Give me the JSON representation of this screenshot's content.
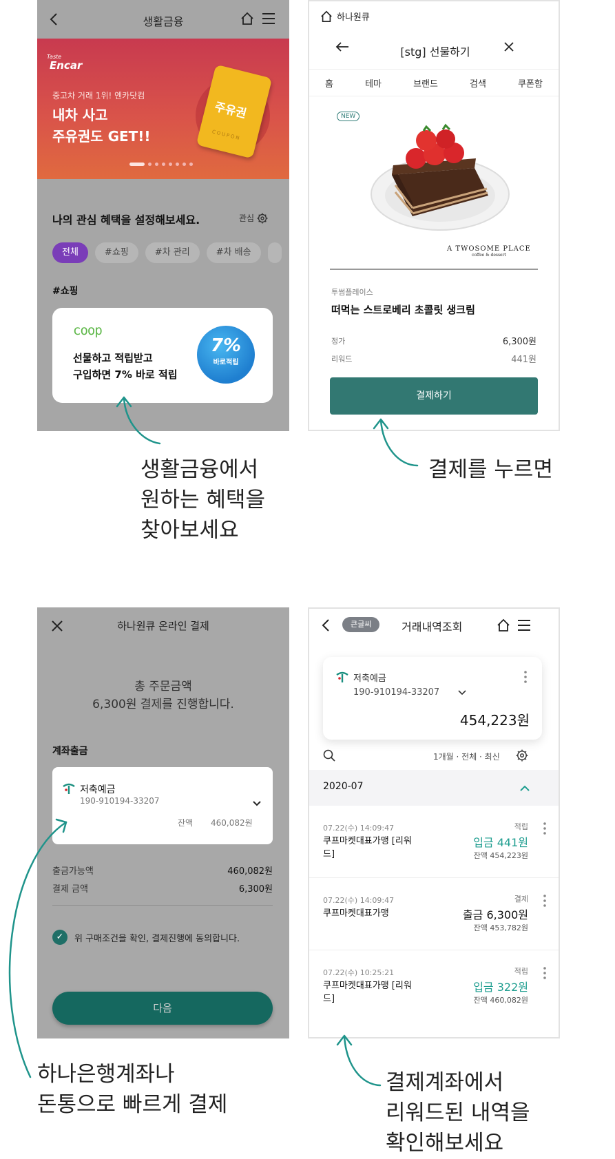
{
  "colors": {
    "teal": "#15685f",
    "purple": "#7a3db8",
    "inflow": "#1f9e90"
  },
  "screen1": {
    "back_icon": "chevron-left-icon",
    "title": "생활금융",
    "home_icon": "home-icon",
    "menu_icon": "hamburger-menu-icon",
    "banner": {
      "logo_small": "Taste",
      "logo": "Encar",
      "subtitle": "중고차 거래 1위! 엔카닷컴",
      "title_line1": "내차 사고",
      "title_line2": "주유권도 GET!!",
      "coupon_text": "주유권",
      "coupon_label": "COUPON",
      "slides_total": 8,
      "slide_active": 1
    },
    "section_title": "나의 관심 혜택을 설정해보세요.",
    "interest_label": "관심",
    "chips": [
      "전체",
      "#쇼핑",
      "#차 관리",
      "#차 배송"
    ],
    "tag_title": "#쇼핑",
    "promo": {
      "logo": "coop",
      "line1": "선물하고 적립받고",
      "line2": "구입하면 7% 바로 적립",
      "badge_pct": "7%",
      "badge_sub": "바로적립"
    }
  },
  "screen2": {
    "brand": "하나원큐",
    "title": "[stg] 선물하기",
    "tabs": [
      "홈",
      "테마",
      "브랜드",
      "검색",
      "쿠폰함"
    ],
    "new_badge": "NEW",
    "brand_mark": "A TWOSOME PLACE",
    "brand_mark_sub": "coffee & dessert",
    "product_brand": "투썸플레이스",
    "product_name": "떠먹는 스트로베리 초콜릿 생크림",
    "price_label": "정가",
    "price": "6,300원",
    "reward_label": "리워드",
    "reward": "441원",
    "pay_button": "결제하기"
  },
  "screen3": {
    "title": "하나원큐 온라인 결제",
    "total_line1": "총 주문금액",
    "total_line2": "6,300원 결제를 진행합니다.",
    "section_label": "계좌출금",
    "account_name": "저축예금",
    "account_number": "190-910194-33207",
    "balance_label": "잔액",
    "balance": "460,082원",
    "available_label": "출금가능액",
    "available": "460,082원",
    "pay_amount_label": "결제 금액",
    "pay_amount": "6,300원",
    "agree_text": "위 구매조건을 확인, 결제진행에 동의합니다.",
    "next_button": "다음"
  },
  "screen4": {
    "badge": "큰글씨",
    "title": "거래내역조회",
    "account_name": "저축예금",
    "account_number": "190-910194-33207",
    "balance": "454,223원",
    "filter": "1개월 · 전체 · 최신",
    "month": "2020-07",
    "transactions": [
      {
        "date": "07.22(수) 14:09:47",
        "desc": "쿠프마켓대표가맹 [리워드]",
        "type": "적립",
        "amount": "입금 441원",
        "balance": "잔액  454,223원"
      },
      {
        "date": "07.22(수) 14:09:47",
        "desc": "쿠프마켓대표가맹",
        "type": "결제",
        "amount": "출금 6,300원",
        "balance": "잔액  453,782원"
      },
      {
        "date": "07.22(수) 10:25:21",
        "desc": "쿠프마켓대표가맹 [리워드]",
        "type": "적립",
        "amount": "입금 322원",
        "balance": "잔액  460,082원"
      }
    ]
  },
  "captions": {
    "c1": "생활금융에서\n원하는 혜택을\n찾아보세요",
    "c2": "결제를 누르면",
    "c3": "하나은행계좌나\n돈통으로 빠르게 결제",
    "c4": "결제계좌에서\n리워드된 내역을\n확인해보세요"
  }
}
